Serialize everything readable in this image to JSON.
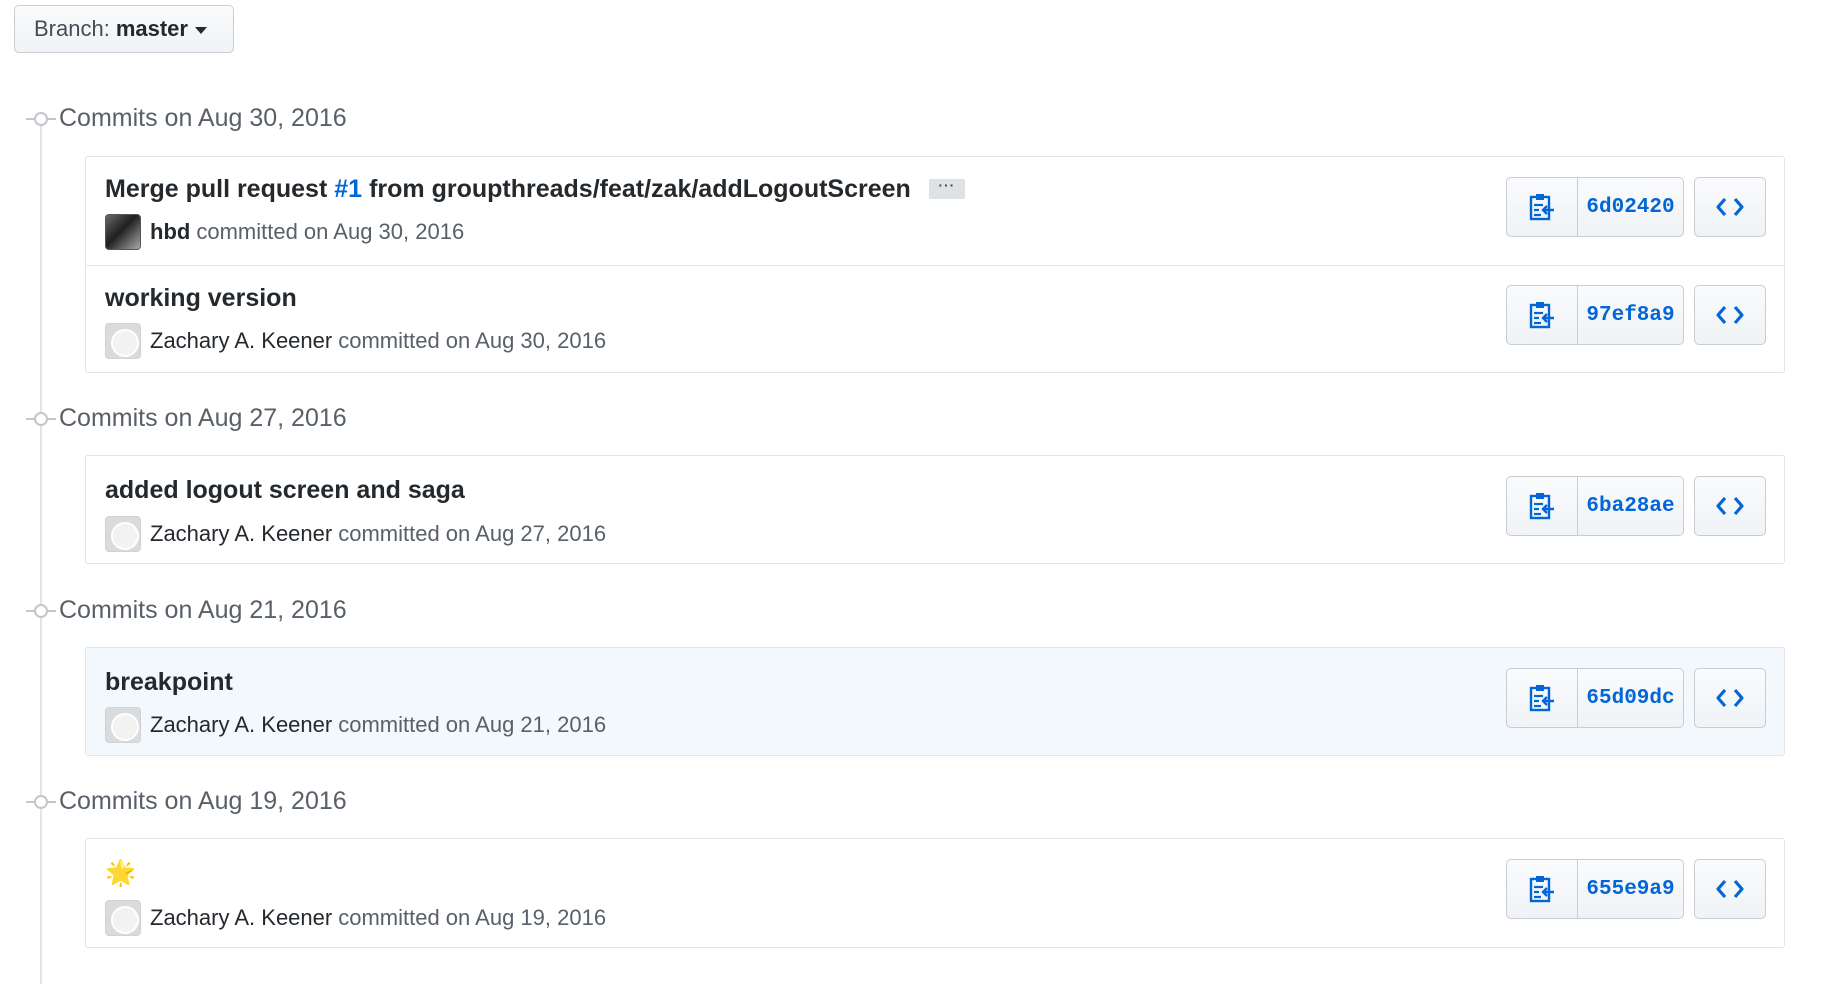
{
  "branch": {
    "label": "Branch:",
    "value": "master"
  },
  "groups": [
    {
      "title": "Commits on Aug 30, 2016",
      "commits": [
        {
          "title_prefix": "Merge pull request",
          "pr_number": "#1",
          "title_suffix": "from groupthreads/feat/zak/addLogoutScreen",
          "ellipsis": "···",
          "author": "hbd",
          "meta": "committed on Aug 30, 2016",
          "sha": "6d02420"
        },
        {
          "title": "working version",
          "author": "Zachary A. Keener",
          "meta": "committed on Aug 30, 2016",
          "sha": "97ef8a9"
        }
      ]
    },
    {
      "title": "Commits on Aug 27, 2016",
      "commits": [
        {
          "title": "added logout screen and saga",
          "author": "Zachary A. Keener",
          "meta": "committed on Aug 27, 2016",
          "sha": "6ba28ae"
        }
      ]
    },
    {
      "title": "Commits on Aug 21, 2016",
      "commits": [
        {
          "title": "breakpoint",
          "author": "Zachary A. Keener",
          "meta": "committed on Aug 21, 2016",
          "sha": "65d09dc"
        }
      ]
    },
    {
      "title": "Commits on Aug 19, 2016",
      "commits": [
        {
          "title": "🌟",
          "author": "Zachary A. Keener",
          "meta": "committed on Aug 19, 2016",
          "sha": "655e9a9"
        }
      ]
    }
  ],
  "colors": {
    "link": "#0366d6",
    "muted": "#586069",
    "border": "#e1e4e8",
    "highlight_row": "#f3f8fd"
  },
  "icons": {
    "copy": "clippy-icon",
    "browse": "code-icon",
    "group": "git-commit-icon",
    "caret": "caret-down-icon"
  }
}
